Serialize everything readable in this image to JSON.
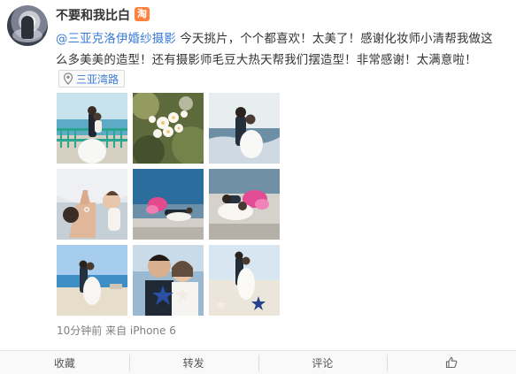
{
  "post": {
    "username": "不要和我比白",
    "badge": "淘",
    "mention": "@三亚克洛伊婚纱摄影",
    "text_line1_rest": " 今天挑片，个个都喜欢！太美了！感谢化妆师小清帮我做这",
    "text_line2": "么多美美的造型！还有摄影师毛豆大热天帮我们摆造型！非常感谢！太满意啦！",
    "location": "三亚湾路",
    "meta": "10分钟前 来自 iPhone 6"
  },
  "icons": {
    "location": "map-pin-icon",
    "like": "thumbs-up-icon"
  },
  "actions": {
    "collect": "收藏",
    "repost": "转发",
    "comment": "评论"
  },
  "colors": {
    "link": "#3a7bd5",
    "badge": "#ff8140",
    "text": "#333333",
    "meta": "#808080"
  },
  "photos": [
    {
      "name": "photo-1"
    },
    {
      "name": "photo-2"
    },
    {
      "name": "photo-3"
    },
    {
      "name": "photo-4"
    },
    {
      "name": "photo-5"
    },
    {
      "name": "photo-6"
    },
    {
      "name": "photo-7"
    },
    {
      "name": "photo-8"
    },
    {
      "name": "photo-9"
    }
  ]
}
